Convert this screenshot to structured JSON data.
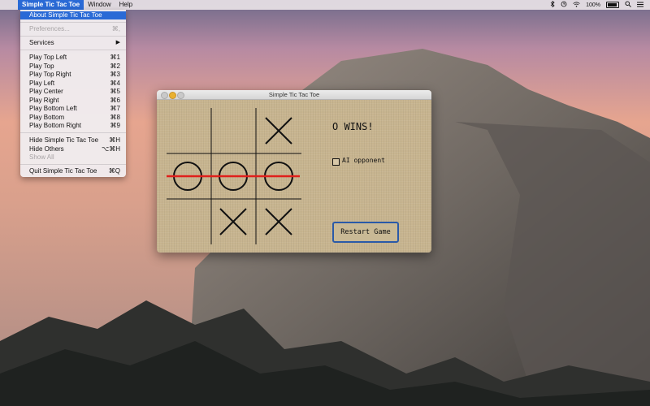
{
  "menubar": {
    "app_menu": "Simple Tic Tac Toe",
    "window_menu": "Window",
    "help_menu": "Help",
    "battery": "100%",
    "status_icons": [
      "bluetooth-icon",
      "time-machine-icon",
      "wifi-icon",
      "battery-icon",
      "search-icon",
      "list-icon"
    ]
  },
  "dropdown": {
    "items": [
      {
        "label": "About Simple Tic Tac Toe",
        "shortcut": "",
        "state": "highlighted"
      },
      {
        "label": "Preferences...",
        "shortcut": "⌘,",
        "state": "disabled"
      },
      {
        "label": "Services",
        "shortcut": "▶",
        "state": "normal"
      },
      {
        "label": "Play Top Left",
        "shortcut": "⌘1",
        "state": "normal"
      },
      {
        "label": "Play Top",
        "shortcut": "⌘2",
        "state": "normal"
      },
      {
        "label": "Play Top Right",
        "shortcut": "⌘3",
        "state": "normal"
      },
      {
        "label": "Play Left",
        "shortcut": "⌘4",
        "state": "normal"
      },
      {
        "label": "Play Center",
        "shortcut": "⌘5",
        "state": "normal"
      },
      {
        "label": "Play Right",
        "shortcut": "⌘6",
        "state": "normal"
      },
      {
        "label": "Play Bottom Left",
        "shortcut": "⌘7",
        "state": "normal"
      },
      {
        "label": "Play Bottom",
        "shortcut": "⌘8",
        "state": "normal"
      },
      {
        "label": "Play Bottom Right",
        "shortcut": "⌘9",
        "state": "normal"
      },
      {
        "label": "Hide Simple Tic Tac Toe",
        "shortcut": "⌘H",
        "state": "normal"
      },
      {
        "label": "Hide Others",
        "shortcut": "⌥⌘H",
        "state": "normal"
      },
      {
        "label": "Show All",
        "shortcut": "",
        "state": "disabled"
      },
      {
        "label": "Quit Simple Tic Tac Toe",
        "shortcut": "⌘Q",
        "state": "normal"
      }
    ]
  },
  "window": {
    "title": "Simple Tic Tac Toe",
    "status": "O WINS!",
    "ai_label": "AI opponent",
    "ai_checked": false,
    "restart_label": "Restart Game",
    "board": [
      "",
      "",
      "X",
      "O",
      "O",
      "O",
      "",
      "X",
      "X"
    ],
    "winning_line": "middle-row",
    "colors": {
      "win_line": "#e0201c",
      "accent": "#2a6ad6"
    }
  }
}
